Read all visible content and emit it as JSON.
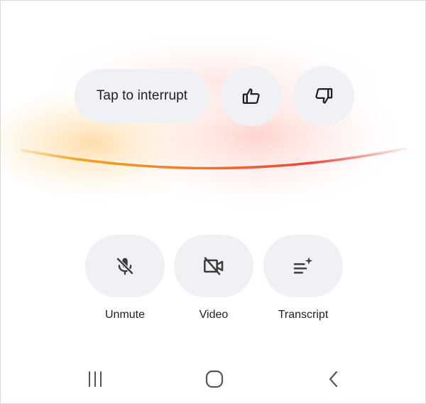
{
  "actions": {
    "interrupt_label": "Tap to interrupt"
  },
  "controls": [
    {
      "id": "unmute",
      "label": "Unmute",
      "icon": "mic-off-icon"
    },
    {
      "id": "video",
      "label": "Video",
      "icon": "video-off-icon"
    },
    {
      "id": "transcript",
      "label": "Transcript",
      "icon": "transcript-sparkle-icon"
    }
  ],
  "rating": {
    "up_icon": "thumb-up-icon",
    "down_icon": "thumb-down-icon"
  },
  "navbar": {
    "recent_icon": "recent-apps-icon",
    "home_icon": "home-icon",
    "back_icon": "back-icon"
  },
  "colors": {
    "button_bg": "#f0f1f4",
    "text": "#1f1f1f",
    "glow_orange": "#f5a623",
    "glow_red": "#e8453c"
  }
}
